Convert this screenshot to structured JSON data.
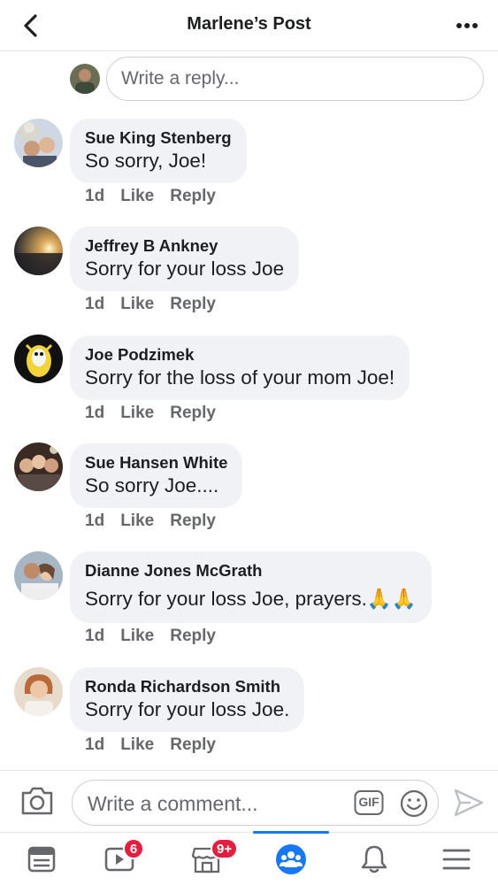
{
  "header": {
    "title": "Marlene’s Post",
    "back_icon": "chevron-left-icon",
    "more_icon": "more-horizontal-icon"
  },
  "reply": {
    "placeholder": "Write a reply..."
  },
  "comments": [
    {
      "author": "Sue King Stenberg",
      "text": "So sorry, Joe!",
      "time": "1d",
      "like": "Like",
      "reply": "Reply"
    },
    {
      "author": "Jeffrey B Ankney",
      "text": "Sorry for your loss Joe",
      "time": "1d",
      "like": "Like",
      "reply": "Reply"
    },
    {
      "author": "Joe Podzimek",
      "text": "Sorry for the loss of your mom Joe!",
      "time": "1d",
      "like": "Like",
      "reply": "Reply"
    },
    {
      "author": "Sue Hansen White",
      "text": "So sorry Joe....",
      "time": "1d",
      "like": "Like",
      "reply": "Reply"
    },
    {
      "author": "Dianne Jones McGrath",
      "text": "Sorry for your loss Joe, prayers.🙏🙏",
      "time": "1d",
      "like": "Like",
      "reply": "Reply"
    },
    {
      "author": "Ronda Richardson Smith",
      "text": "Sorry for your loss Joe.",
      "time": "1d",
      "like": "Like",
      "reply": "Reply"
    }
  ],
  "composer": {
    "placeholder": "Write a comment...",
    "gif_label": "GIF"
  },
  "tabbar": {
    "badges": {
      "watch": "6",
      "marketplace": "9+"
    }
  },
  "colors": {
    "accent": "#1877f2",
    "badge": "#e41e3f",
    "bubble": "#f0f2f5",
    "secondary_text": "#65676b"
  }
}
